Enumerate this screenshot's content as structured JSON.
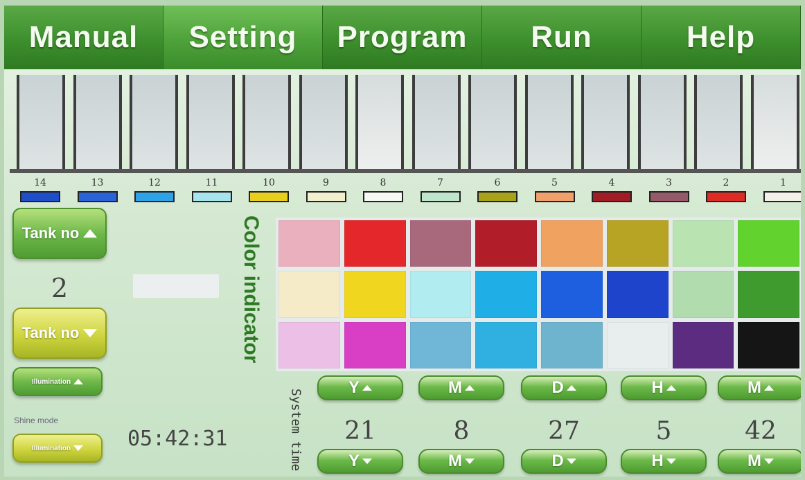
{
  "tabs": [
    {
      "label": "Manual",
      "active": false
    },
    {
      "label": "Setting",
      "active": true
    },
    {
      "label": "Program",
      "active": false
    },
    {
      "label": "Run",
      "active": false
    },
    {
      "label": "Help",
      "active": false
    }
  ],
  "tanks": [
    {
      "no": "14",
      "color": "#1f4fc8"
    },
    {
      "no": "13",
      "color": "#2a63d8"
    },
    {
      "no": "12",
      "color": "#2ea2e6"
    },
    {
      "no": "11",
      "color": "#a8e4ee"
    },
    {
      "no": "10",
      "color": "#e8cf1f"
    },
    {
      "no": "9",
      "color": "#f2efcf"
    },
    {
      "no": "8",
      "color": "#f7f7f4"
    },
    {
      "no": "7",
      "color": "#bfe6cd"
    },
    {
      "no": "6",
      "color": "#a8a21a"
    },
    {
      "no": "5",
      "color": "#f0a06a"
    },
    {
      "no": "4",
      "color": "#a11d25"
    },
    {
      "no": "3",
      "color": "#955a6a"
    },
    {
      "no": "2",
      "color": "#dd2b25"
    },
    {
      "no": "1",
      "color": "#f4efe9"
    }
  ],
  "left_panel": {
    "tank_up_label": "Tank no",
    "tank_down_label": "Tank no",
    "tank_value": "2",
    "illumination_up_label": "Illumination",
    "illumination_down_label": "Illumination",
    "shine_mode_label": "Shine mode",
    "clock": "05:42:31"
  },
  "color_indicator_label": "Color indicator",
  "color_grid": [
    "#eab0bd",
    "#e3272a",
    "#a8697c",
    "#b11e2a",
    "#f0a260",
    "#b7a324",
    "#b9e4b2",
    "#62d22f",
    "#f5ebc8",
    "#f0d61e",
    "#b0ecf0",
    "#20aee6",
    "#1e5fe0",
    "#1f44cc",
    "#b0dcae",
    "#3f9b2d",
    "#ecbfe6",
    "#d93fc4",
    "#70b6d6",
    "#2fb0e0",
    "#6fb4cf",
    "#e8eded",
    "#5c2c80",
    "#151515"
  ],
  "system_time": {
    "label": "System time",
    "fields": [
      {
        "key": "year",
        "letter": "Y",
        "value": "21"
      },
      {
        "key": "month",
        "letter": "M",
        "value": "8"
      },
      {
        "key": "day",
        "letter": "D",
        "value": "27"
      },
      {
        "key": "hour",
        "letter": "H",
        "value": "5"
      },
      {
        "key": "minute",
        "letter": "M",
        "value": "42"
      }
    ]
  }
}
